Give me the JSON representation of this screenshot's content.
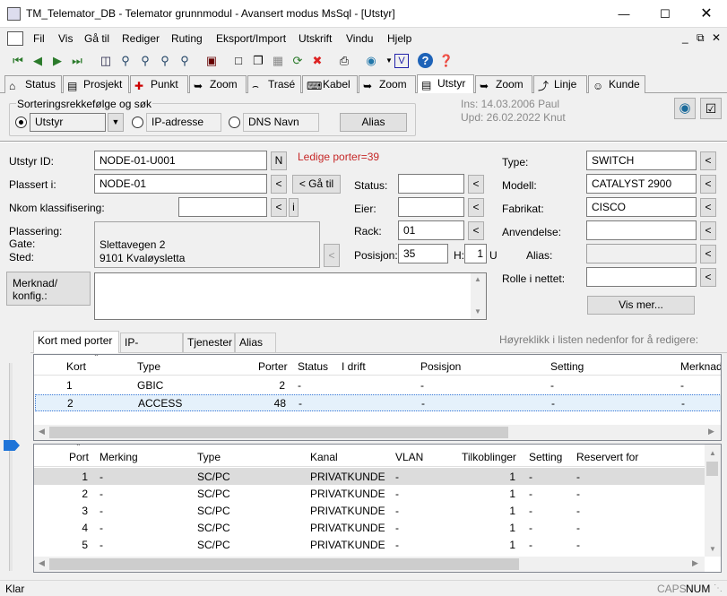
{
  "window": {
    "title": "TM_Telemator_DB - Telemator grunnmodul - Avansert modus MsSql - [Utstyr]"
  },
  "menu": [
    "Fil",
    "Vis",
    "Gå til",
    "Rediger",
    "Ruting",
    "Eksport/Import",
    "Utskrift",
    "Vindu",
    "Hjelp"
  ],
  "tabs": [
    {
      "label": "Status",
      "icon": "status-icon"
    },
    {
      "label": "Prosjekt",
      "icon": "project-icon"
    },
    {
      "label": "Punkt",
      "icon": "point-icon"
    },
    {
      "label": "Zoom",
      "icon": "zoom-icon"
    },
    {
      "label": "Trasé",
      "icon": "route-icon"
    },
    {
      "label": "Kabel",
      "icon": "cable-icon"
    },
    {
      "label": "Zoom",
      "icon": "zoom-icon"
    },
    {
      "label": "Utstyr",
      "icon": "equipment-icon"
    },
    {
      "label": "Zoom",
      "icon": "zoom-icon"
    },
    {
      "label": "Linje",
      "icon": "line-icon"
    },
    {
      "label": "Kunde",
      "icon": "customer-icon"
    }
  ],
  "sort": {
    "title": "Sorteringsrekkefølge og søk",
    "utstyr": "Utstyr",
    "ip": "IP-adresse",
    "dns": "DNS Navn",
    "alias": "Alias"
  },
  "info": {
    "ins": "Ins: 14.03.2006 Paul",
    "upd": "Upd: 26.02.2022 Knut"
  },
  "form": {
    "utstyr_id_label": "Utstyr ID:",
    "utstyr_id": "NODE-01-U001",
    "n_btn": "N",
    "ledige": "Ledige porter=39",
    "plassert_label": "Plassert i:",
    "plassert": "NODE-01",
    "lt": "<",
    "ga_til": "< Gå til",
    "nkom_label": "Nkom klassifisering:",
    "nkom": "",
    "i_btn": "i",
    "plassering_label": "Plassering:",
    "gate_label": "Gate:",
    "sted_label": "Sted:",
    "gate": "Slettavegen 2",
    "sted": "9101 Kvaløysletta",
    "merknad_btn": "Merknad/\nkonfig.:",
    "merknad": "",
    "status_label": "Status:",
    "status": "",
    "eier_label": "Eier:",
    "eier": "",
    "rack_label": "Rack:",
    "rack": "01",
    "posisjon_label": "Posisjon:",
    "posisjon": "35",
    "h_label": "H:",
    "h": "1",
    "u": "U",
    "type_label": "Type:",
    "type": "SWITCH",
    "modell_label": "Modell:",
    "modell": "CATALYST 2900",
    "fabrikat_label": "Fabrikat:",
    "fabrikat": "CISCO",
    "anvendelse_label": "Anvendelse:",
    "anvendelse": "",
    "alias_label": "Alias:",
    "alias": "",
    "rolle_label": "Rolle i nettet:",
    "rolle": "",
    "vis_mer": "Vis mer..."
  },
  "subtabs": [
    "Kort med porter",
    "IP-adresser",
    "Tjenester",
    "Alias"
  ],
  "hint": "Høyreklikk i listen nedenfor for å redigere:",
  "cards": {
    "headers": [
      "Kort",
      "Type",
      "Porter",
      "Status",
      "I drift",
      "Posisjon",
      "Setting",
      "Merknad"
    ],
    "rows": [
      [
        "1",
        "GBIC",
        "2",
        "-",
        "",
        "-",
        "-",
        "-"
      ],
      [
        "2",
        "ACCESS",
        "48",
        "-",
        "",
        "-",
        "-",
        "-"
      ]
    ]
  },
  "ports": {
    "headers": [
      "Port",
      "Merking",
      "Type",
      "Kanal",
      "VLAN",
      "Tilkoblinger",
      "Setting",
      "Reservert for"
    ],
    "rows": [
      [
        "1",
        "-",
        "SC/PC",
        "PRIVATKUNDE",
        "-",
        "1",
        "-",
        "-"
      ],
      [
        "2",
        "-",
        "SC/PC",
        "PRIVATKUNDE",
        "-",
        "1",
        "-",
        "-"
      ],
      [
        "3",
        "-",
        "SC/PC",
        "PRIVATKUNDE",
        "-",
        "1",
        "-",
        "-"
      ],
      [
        "4",
        "-",
        "SC/PC",
        "PRIVATKUNDE",
        "-",
        "1",
        "-",
        "-"
      ],
      [
        "5",
        "-",
        "SC/PC",
        "PRIVATKUNDE",
        "-",
        "1",
        "-",
        "-"
      ]
    ]
  },
  "status": {
    "text": "Klar",
    "caps": "CAPS",
    "num": "NUM"
  }
}
